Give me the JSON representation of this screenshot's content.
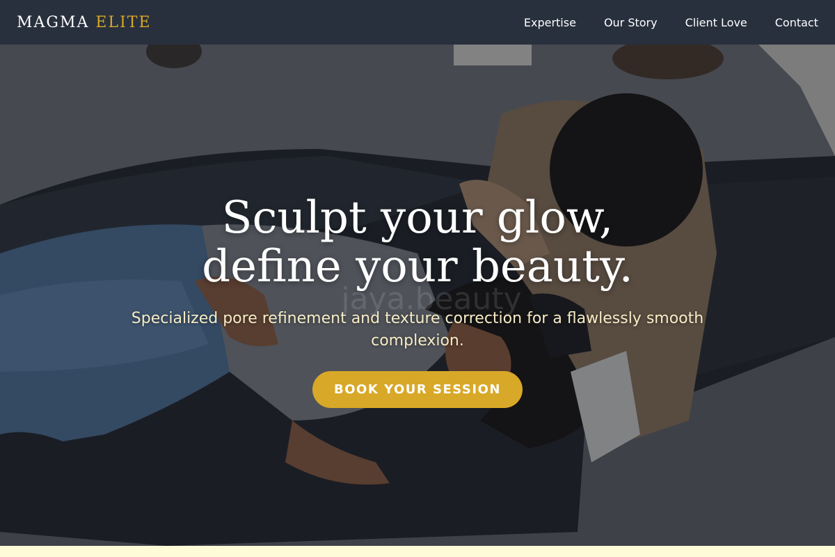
{
  "nav": {
    "brand_primary": "MAGMA",
    "brand_accent": "ELITE",
    "links": [
      {
        "label": "Expertise"
      },
      {
        "label": "Our Story"
      },
      {
        "label": "Client Love"
      },
      {
        "label": "Contact"
      }
    ]
  },
  "hero": {
    "headline_line1": "Sculpt your glow,",
    "headline_line2": "define your beauty.",
    "subheadline": "Specialized pore refinement and texture correction for a flawlessly smooth complexion.",
    "cta_label": "BOOK YOUR SESSION",
    "photo_watermark": "jaya.beauty"
  },
  "colors": {
    "nav_bg": "#28303d",
    "accent": "#d8a828",
    "page_bg": "#fdfbd8",
    "subhead_text": "#f6ecc6"
  }
}
